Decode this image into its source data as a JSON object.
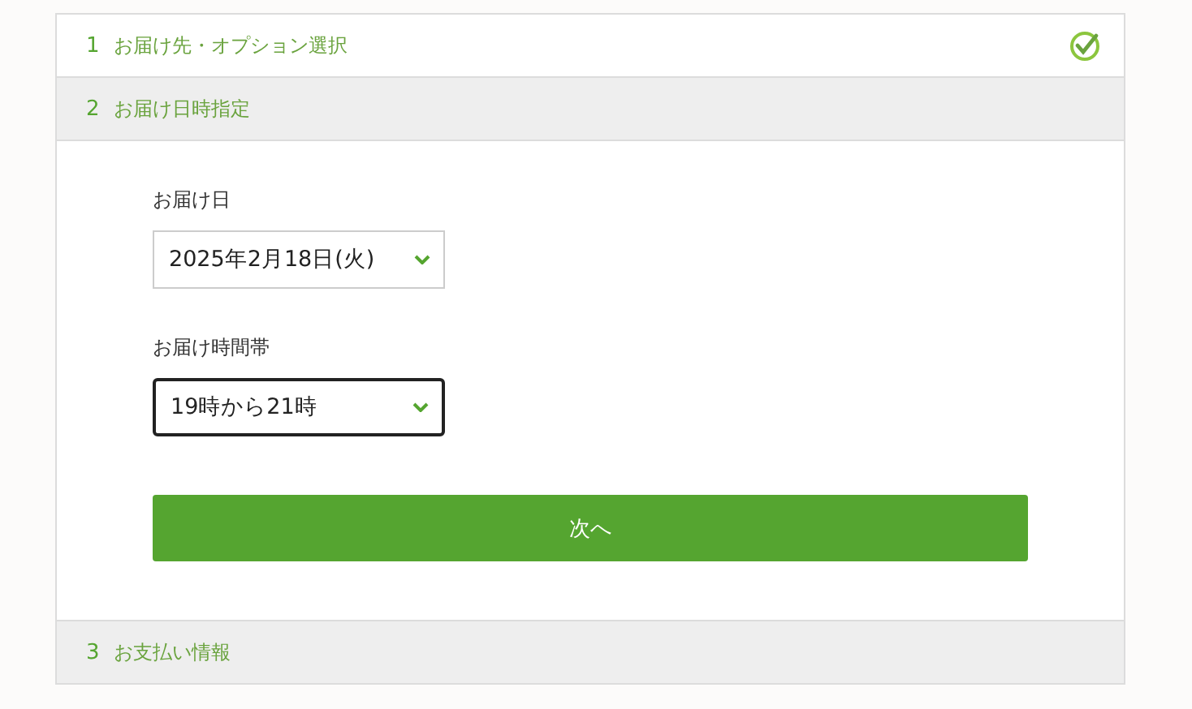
{
  "steps": [
    {
      "number": "1",
      "title": "お届け先・オプション選択",
      "completed": true
    },
    {
      "number": "2",
      "title": "お届け日時指定",
      "completed": false,
      "fields": [
        {
          "label": "お届け日",
          "value": "2025年2月18日(火)",
          "focused": false
        },
        {
          "label": "お届け時間帯",
          "value": "19時から21時",
          "focused": true
        }
      ],
      "button": "次へ"
    },
    {
      "number": "3",
      "title": "お支払い情報",
      "completed": false
    }
  ]
}
